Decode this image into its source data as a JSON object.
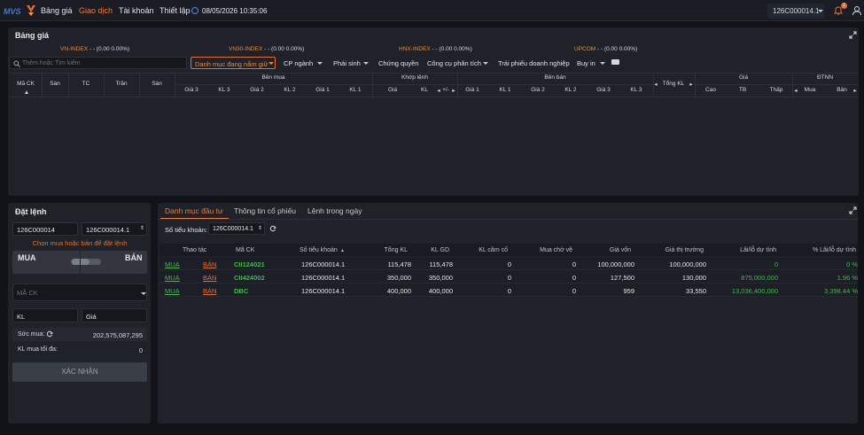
{
  "topbar": {
    "logo": "MVS",
    "nav": [
      "Bảng giá",
      "Giao dịch",
      "Tài khoản",
      "Thiết lập"
    ],
    "active_nav": "Giao dịch",
    "datetime": "08/05/2026 10:35:06",
    "account": "126C000014.1",
    "notification_count": "1"
  },
  "board": {
    "title": "Bảng giá",
    "indices": [
      {
        "name": "VN-INDEX",
        "value": " - - (0.00 0.00%)"
      },
      {
        "name": "VN30-INDEX",
        "value": " - - (0.00 0.00%)"
      },
      {
        "name": "HNX-INDEX",
        "value": " - - (0.00 0.00%)"
      },
      {
        "name": "UPCOM",
        "value": " - - (0.00 0.00%)"
      }
    ],
    "search_placeholder": "Thêm hoặc Tìm kiếm",
    "active_filter": "Danh mục đang nắm giữ",
    "filters": [
      "CP ngành",
      "Phái sinh",
      "Chứng quyền",
      "Công cụ phân tích",
      "Trái phiếu doanh nghiệp",
      "Buy in"
    ],
    "columns": {
      "ma_ck": "Mã CK",
      "san": "Sàn",
      "tc": "TC",
      "tran": "Trần",
      "san2": "Sàn",
      "ben_mua": "Bên mua",
      "gia3": "Giá 3",
      "kl3": "KL 3",
      "gia2": "Giá 2",
      "kl2": "KL 2",
      "gia1": "Giá 1",
      "kl1": "KL 1",
      "khop_lenh": "Khớp lệnh",
      "gia": "Giá",
      "kl": "KL",
      "pm": "+/-",
      "ben_ban": "Bên bán",
      "tong_kl": "Tổng KL",
      "gia_grp": "Giá",
      "cao": "Cao",
      "tb": "TB",
      "thap": "Thấp",
      "dtnn": "ĐTNN",
      "mua": "Mua",
      "ban": "Bán"
    }
  },
  "order": {
    "title": "Đặt lệnh",
    "account_input": "126C000014",
    "sub_account": "126C000014.1",
    "hint": "Chọn mua hoặc bán để đặt lệnh",
    "buy_label": "MUA",
    "sell_label": "BÁN",
    "symbol_placeholder": "MÃ CK",
    "qty_placeholder": "KL",
    "price_placeholder": "Giá",
    "buying_power_label": "Sức mua:",
    "buying_power": "202,575,087,295",
    "max_qty_label": "KL mua tối đa:",
    "max_qty": "0",
    "submit": "XÁC NHẬN"
  },
  "portfolio": {
    "tabs": [
      "Danh mục đầu tư",
      "Thông tin cổ phiếu",
      "Lệnh trong ngày"
    ],
    "sub_account_label": "Số tiểu khoản:",
    "sub_account": "126C000014.1",
    "headers": [
      "Thao tác",
      "Mã CK",
      "Số tiểu khoản",
      "Tổng KL",
      "KL GD",
      "KL cầm cố",
      "Mua chờ về",
      "Giá vốn",
      "Giá thị trường",
      "Lãi/lỗ dự tính",
      "% Lãi/lỗ dự tính"
    ],
    "buy_action": "MUA",
    "sell_action": "BÁN",
    "rows": [
      {
        "symbol": "CII124021",
        "account": "126C000014.1",
        "total": "115,478",
        "tradable": "115,478",
        "pledged": "0",
        "pending": "0",
        "cost": "100,000,000",
        "market": "100,000,000",
        "pnl": "0",
        "pnl_pct": "0 %"
      },
      {
        "symbol": "CII424002",
        "account": "126C000014.1",
        "total": "350,000",
        "tradable": "350,000",
        "pledged": "0",
        "pending": "0",
        "cost": "127,500",
        "market": "130,000",
        "pnl": "875,000,000",
        "pnl_pct": "1.96 %"
      },
      {
        "symbol": "DBC",
        "account": "126C000014.1",
        "total": "400,000",
        "tradable": "400,000",
        "pledged": "0",
        "pending": "0",
        "cost": "959",
        "market": "33,550",
        "pnl": "13,036,400,000",
        "pnl_pct": "3,398.44 %"
      }
    ]
  }
}
